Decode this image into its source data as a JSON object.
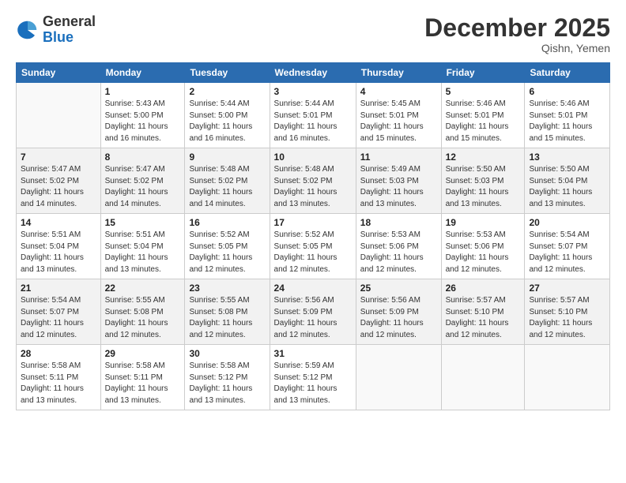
{
  "header": {
    "logo_general": "General",
    "logo_blue": "Blue",
    "month_title": "December 2025",
    "subtitle": "Qishn, Yemen"
  },
  "weekdays": [
    "Sunday",
    "Monday",
    "Tuesday",
    "Wednesday",
    "Thursday",
    "Friday",
    "Saturday"
  ],
  "weeks": [
    [
      {
        "day": "",
        "info": ""
      },
      {
        "day": "1",
        "info": "Sunrise: 5:43 AM\nSunset: 5:00 PM\nDaylight: 11 hours\nand 16 minutes."
      },
      {
        "day": "2",
        "info": "Sunrise: 5:44 AM\nSunset: 5:00 PM\nDaylight: 11 hours\nand 16 minutes."
      },
      {
        "day": "3",
        "info": "Sunrise: 5:44 AM\nSunset: 5:01 PM\nDaylight: 11 hours\nand 16 minutes."
      },
      {
        "day": "4",
        "info": "Sunrise: 5:45 AM\nSunset: 5:01 PM\nDaylight: 11 hours\nand 15 minutes."
      },
      {
        "day": "5",
        "info": "Sunrise: 5:46 AM\nSunset: 5:01 PM\nDaylight: 11 hours\nand 15 minutes."
      },
      {
        "day": "6",
        "info": "Sunrise: 5:46 AM\nSunset: 5:01 PM\nDaylight: 11 hours\nand 15 minutes."
      }
    ],
    [
      {
        "day": "7",
        "info": "Sunrise: 5:47 AM\nSunset: 5:02 PM\nDaylight: 11 hours\nand 14 minutes."
      },
      {
        "day": "8",
        "info": "Sunrise: 5:47 AM\nSunset: 5:02 PM\nDaylight: 11 hours\nand 14 minutes."
      },
      {
        "day": "9",
        "info": "Sunrise: 5:48 AM\nSunset: 5:02 PM\nDaylight: 11 hours\nand 14 minutes."
      },
      {
        "day": "10",
        "info": "Sunrise: 5:48 AM\nSunset: 5:02 PM\nDaylight: 11 hours\nand 13 minutes."
      },
      {
        "day": "11",
        "info": "Sunrise: 5:49 AM\nSunset: 5:03 PM\nDaylight: 11 hours\nand 13 minutes."
      },
      {
        "day": "12",
        "info": "Sunrise: 5:50 AM\nSunset: 5:03 PM\nDaylight: 11 hours\nand 13 minutes."
      },
      {
        "day": "13",
        "info": "Sunrise: 5:50 AM\nSunset: 5:04 PM\nDaylight: 11 hours\nand 13 minutes."
      }
    ],
    [
      {
        "day": "14",
        "info": "Sunrise: 5:51 AM\nSunset: 5:04 PM\nDaylight: 11 hours\nand 13 minutes."
      },
      {
        "day": "15",
        "info": "Sunrise: 5:51 AM\nSunset: 5:04 PM\nDaylight: 11 hours\nand 13 minutes."
      },
      {
        "day": "16",
        "info": "Sunrise: 5:52 AM\nSunset: 5:05 PM\nDaylight: 11 hours\nand 12 minutes."
      },
      {
        "day": "17",
        "info": "Sunrise: 5:52 AM\nSunset: 5:05 PM\nDaylight: 11 hours\nand 12 minutes."
      },
      {
        "day": "18",
        "info": "Sunrise: 5:53 AM\nSunset: 5:06 PM\nDaylight: 11 hours\nand 12 minutes."
      },
      {
        "day": "19",
        "info": "Sunrise: 5:53 AM\nSunset: 5:06 PM\nDaylight: 11 hours\nand 12 minutes."
      },
      {
        "day": "20",
        "info": "Sunrise: 5:54 AM\nSunset: 5:07 PM\nDaylight: 11 hours\nand 12 minutes."
      }
    ],
    [
      {
        "day": "21",
        "info": "Sunrise: 5:54 AM\nSunset: 5:07 PM\nDaylight: 11 hours\nand 12 minutes."
      },
      {
        "day": "22",
        "info": "Sunrise: 5:55 AM\nSunset: 5:08 PM\nDaylight: 11 hours\nand 12 minutes."
      },
      {
        "day": "23",
        "info": "Sunrise: 5:55 AM\nSunset: 5:08 PM\nDaylight: 11 hours\nand 12 minutes."
      },
      {
        "day": "24",
        "info": "Sunrise: 5:56 AM\nSunset: 5:09 PM\nDaylight: 11 hours\nand 12 minutes."
      },
      {
        "day": "25",
        "info": "Sunrise: 5:56 AM\nSunset: 5:09 PM\nDaylight: 11 hours\nand 12 minutes."
      },
      {
        "day": "26",
        "info": "Sunrise: 5:57 AM\nSunset: 5:10 PM\nDaylight: 11 hours\nand 12 minutes."
      },
      {
        "day": "27",
        "info": "Sunrise: 5:57 AM\nSunset: 5:10 PM\nDaylight: 11 hours\nand 12 minutes."
      }
    ],
    [
      {
        "day": "28",
        "info": "Sunrise: 5:58 AM\nSunset: 5:11 PM\nDaylight: 11 hours\nand 13 minutes."
      },
      {
        "day": "29",
        "info": "Sunrise: 5:58 AM\nSunset: 5:11 PM\nDaylight: 11 hours\nand 13 minutes."
      },
      {
        "day": "30",
        "info": "Sunrise: 5:58 AM\nSunset: 5:12 PM\nDaylight: 11 hours\nand 13 minutes."
      },
      {
        "day": "31",
        "info": "Sunrise: 5:59 AM\nSunset: 5:12 PM\nDaylight: 11 hours\nand 13 minutes."
      },
      {
        "day": "",
        "info": ""
      },
      {
        "day": "",
        "info": ""
      },
      {
        "day": "",
        "info": ""
      }
    ]
  ]
}
